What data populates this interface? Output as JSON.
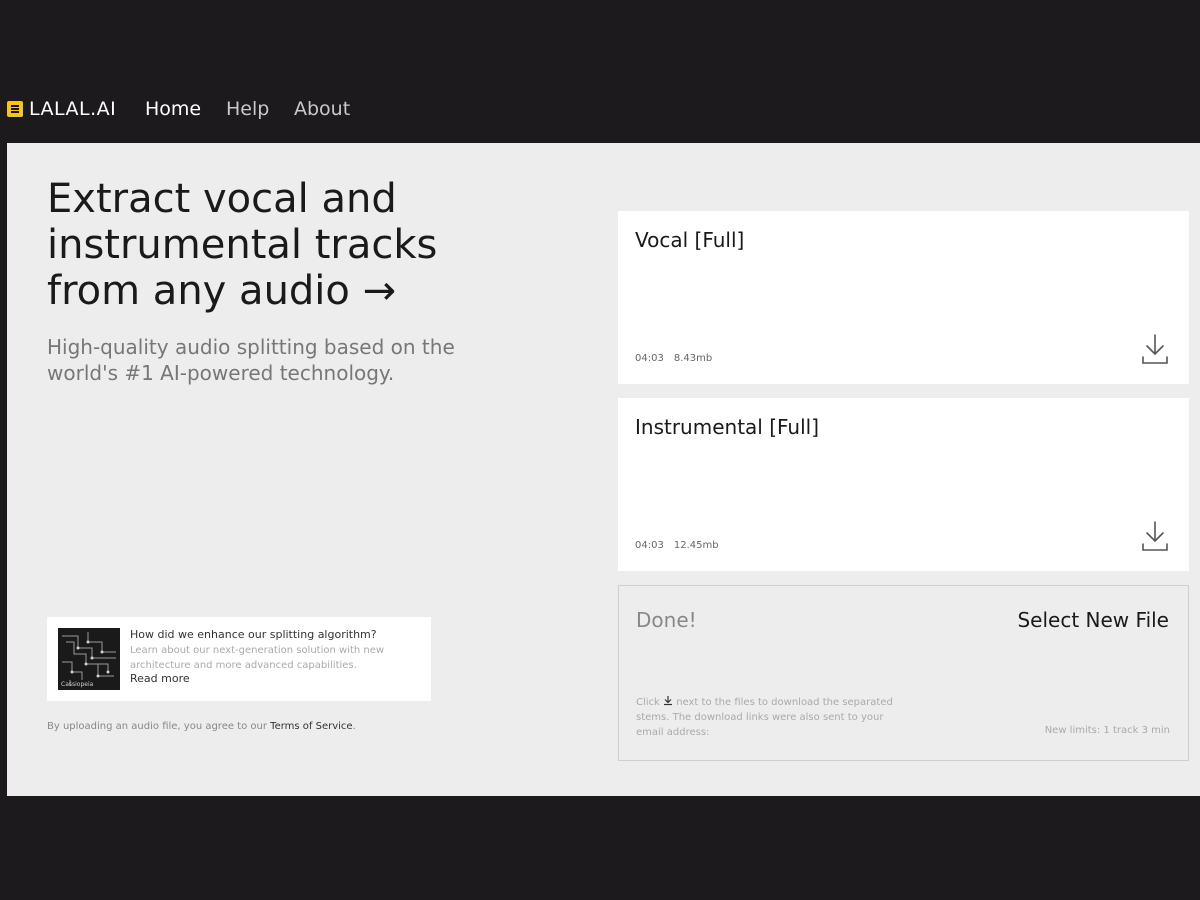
{
  "header": {
    "logo_text": "LALAL.AI",
    "nav": [
      {
        "label": "Home"
      },
      {
        "label": "Help"
      },
      {
        "label": "About"
      }
    ]
  },
  "hero": {
    "headline": "Extract vocal and instrumental tracks from any audio →",
    "subtitle": "High-quality audio splitting based on the world's #1 AI-powered technology."
  },
  "promo": {
    "thumb_label": "Cassiopeia",
    "title": "How did we enhance our splitting algorithm?",
    "description": "Learn about our next-generation solution with new architecture and more advanced capabilities.",
    "link": "Read more"
  },
  "terms": {
    "prefix": "By uploading an audio file, you agree to our ",
    "link": "Terms of Service",
    "suffix": "."
  },
  "tracks": [
    {
      "title": "Vocal [Full]",
      "duration": "04:03",
      "size": "8.43mb",
      "icon": "download-icon"
    },
    {
      "title": "Instrumental [Full]",
      "duration": "04:03",
      "size": "12.45mb",
      "icon": "download-icon"
    }
  ],
  "status": {
    "title": "Done!",
    "select_button": "Select New File",
    "info_prefix": "Click",
    "info_suffix": "next to the files to download the separated stems. The download links were also sent to your email address:",
    "limits": "New limits: 1 track 3 min"
  },
  "colors": {
    "accent": "#f5c518",
    "background": "#1c1a1d",
    "panel": "#ededed"
  }
}
